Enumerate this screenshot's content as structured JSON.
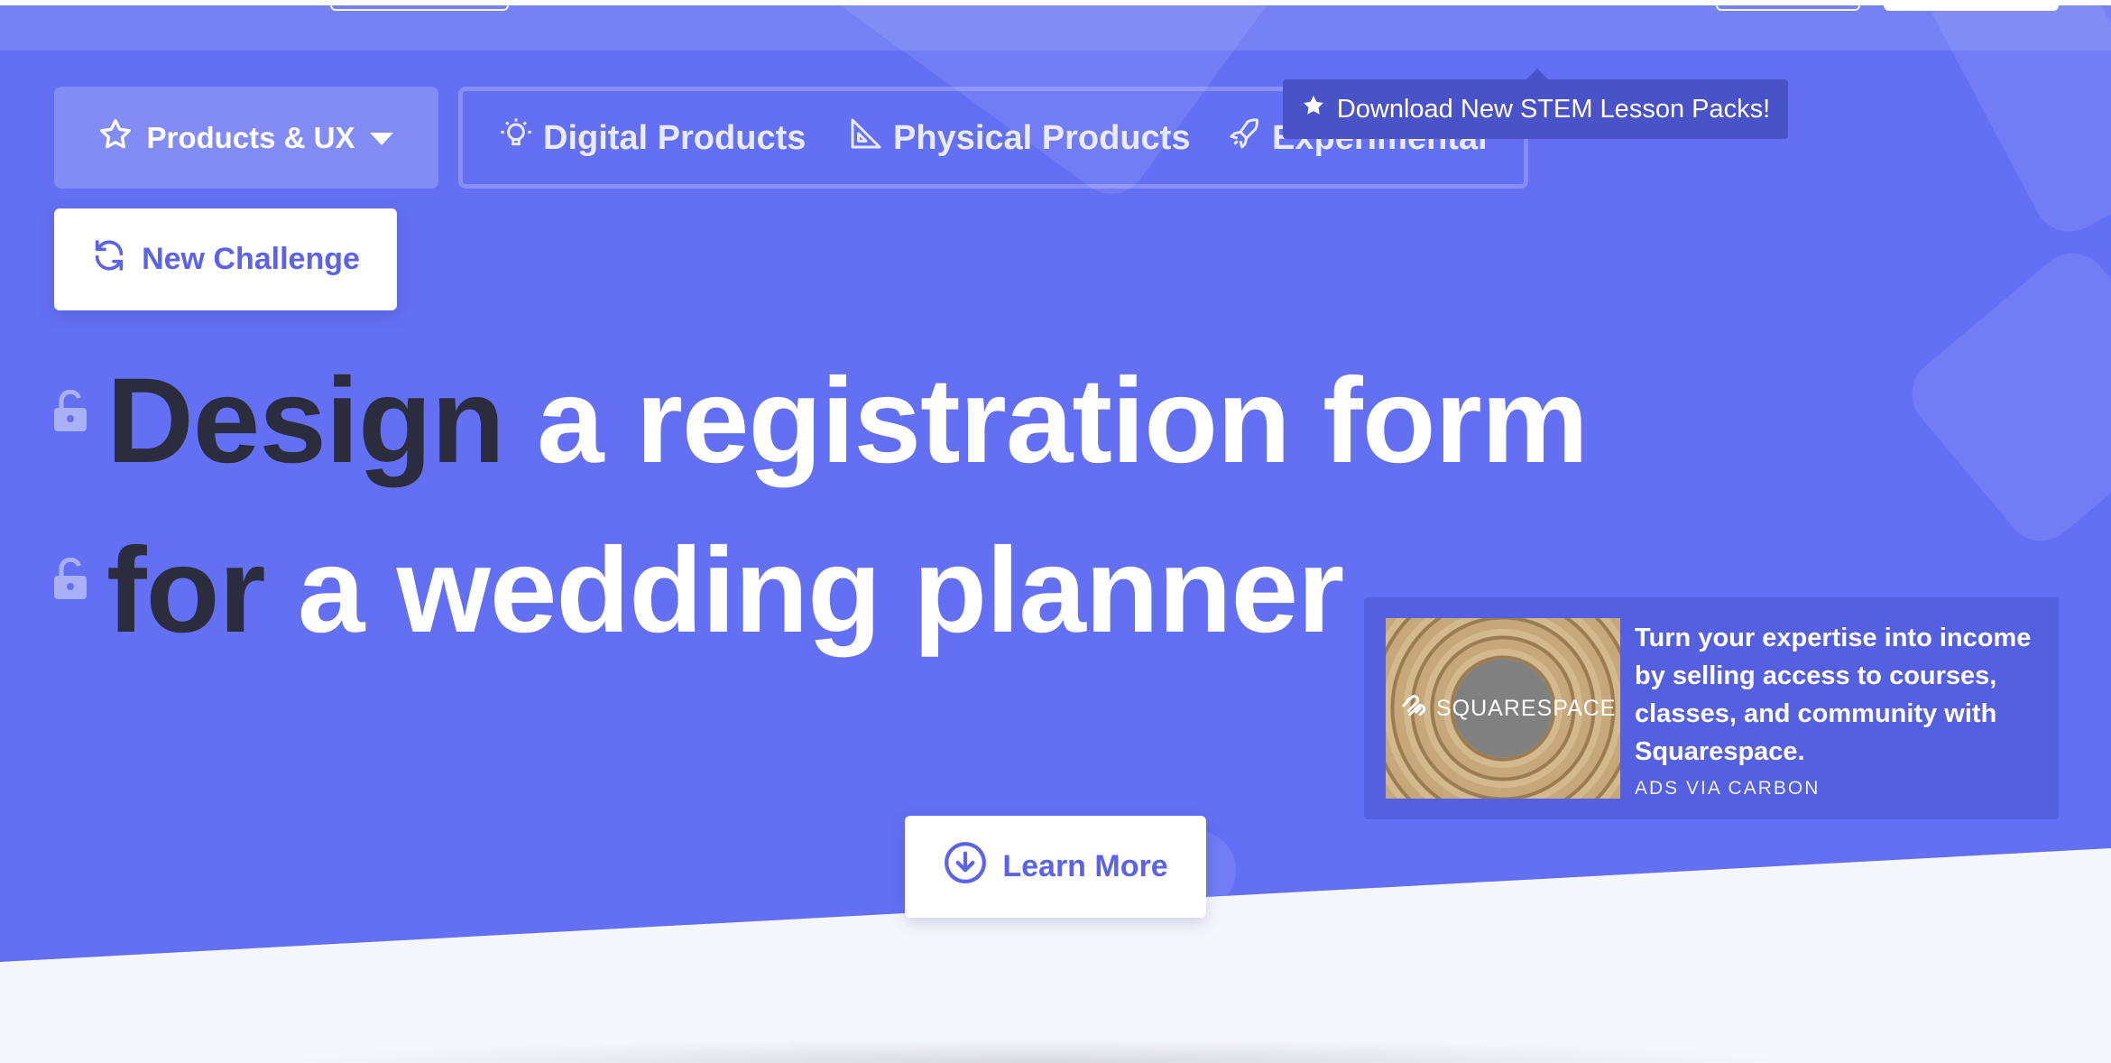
{
  "nav": {
    "category_dropdown": {
      "label": "Products & UX",
      "icon": "star-outline-icon",
      "caret": "caret-down-icon"
    },
    "categories": [
      {
        "label": "Digital Products",
        "icon": "lightbulb-icon"
      },
      {
        "label": "Physical Products",
        "icon": "set-square-icon"
      },
      {
        "label": "Experimental",
        "icon": "rocket-icon"
      }
    ]
  },
  "tooltip": {
    "text": "Download New STEM Lesson Packs!",
    "icon": "star-solid-icon"
  },
  "new_challenge": {
    "label": "New Challenge",
    "icon": "refresh-icon"
  },
  "challenge": {
    "line1": {
      "lead": "Design",
      "rest": "a registration form"
    },
    "line2": {
      "lead": "for",
      "rest": "a wedding planner"
    },
    "lock_icon": "unlocked-padlock-icon"
  },
  "ad": {
    "image_brand": "SQUARESPACE",
    "text": "Turn your expertise into income by selling access to courses, classes, and community with Squarespace.",
    "via": "ADS VIA CARBON"
  },
  "learn_more": {
    "label": "Learn More",
    "icon": "arrow-down-circle-icon"
  },
  "colors": {
    "hero_bg": "#6470f3",
    "accent": "#5b63e8",
    "dark_text": "#2b2d3f"
  }
}
